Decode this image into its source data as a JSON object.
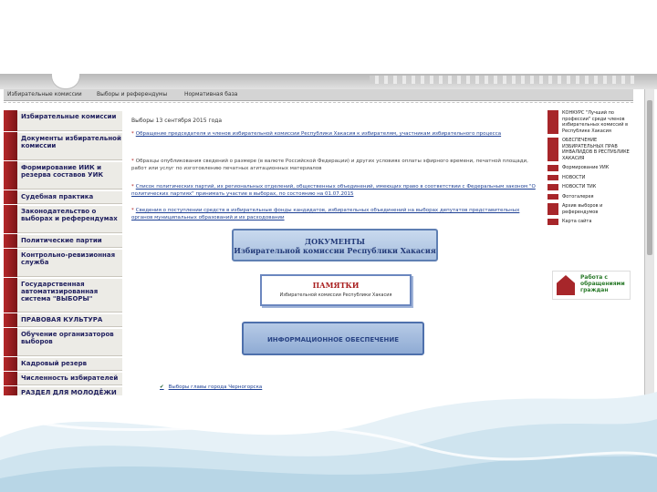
{
  "nav": {
    "tabs": [
      "Избирательные комиссии",
      "Выборы и референдумы",
      "Нормативная база"
    ]
  },
  "left_menu": [
    "Избирательные комиссии",
    "Документы избирательной комиссии",
    "Формирование ИИК и резерва составов УИК",
    "Судебная практика",
    "Законодательство о выборах и референдумах",
    "Политические партии",
    "Контрольно-ревизионная служба",
    "Государственная автоматизированная система \"ВЫБОРЫ\"",
    "ПРАВОВАЯ КУЛЬТУРА",
    "Обучение организаторов выборов",
    "Кадровый резерв",
    "Численность избирателей",
    "РАЗДЕЛ ДЛЯ МОЛОДЁЖИ"
  ],
  "main": {
    "title": "Выборы 13 сентября 2015 года",
    "news": [
      "Обращение председателя и членов избирательной комиссии Республики Хакасия к избирателям, участникам избирательного процесса",
      "Образцы опубликования сведений о размере (в валюте Российской Федерации) и других условиях оплаты эфирного времени, печатной площади, работ или услуг по изготовлению печатных агитационных материалов",
      "Список политических партий, их региональных отделений, общественных объединений, имеющих право в соответствии с Федеральным законом \"О политических партиях\" принимать участие в выборах, по состоянию на 01.07.2015",
      "Сведения о поступлении средств в избирательные фонды кандидатов, избирательных объединений на выборах депутатов представительных органов муниципальных образований и их расходовании"
    ],
    "banner_docs": [
      "ДОКУМЕНТЫ",
      "Избирательной комиссии Республики Хакасия"
    ],
    "banner_memo": [
      "ПАМЯТКИ",
      "Избирательной комиссии Республики Хакасия"
    ],
    "banner_info": "ИНФОРМАЦИОННОЕ ОБЕСПЕЧЕНИЕ",
    "bottom_link": "Выборы главы города Черногорска"
  },
  "right_menu": [
    "КОНКУРС \"Лучший по профессии\" среди членов избирательных комиссий в Республике Хакасия",
    "ОБЕСПЕЧЕНИЕ ИЗБИРАТЕЛЬНЫХ ПРАВ ИНВАЛИДОВ В РЕСПУБЛИКЕ ХАКАСИЯ",
    "Формирование УИК",
    "НОВОСТИ",
    "НОВОСТИ ТИК",
    "Фотогалерея",
    "Архив выборов и референдумов",
    "Карта сайта"
  ],
  "right_logo": "Работа с обращениями граждан",
  "colors": {
    "accent": "#a7262a",
    "banner": "#5f7fb3",
    "link": "#1c3f94"
  }
}
